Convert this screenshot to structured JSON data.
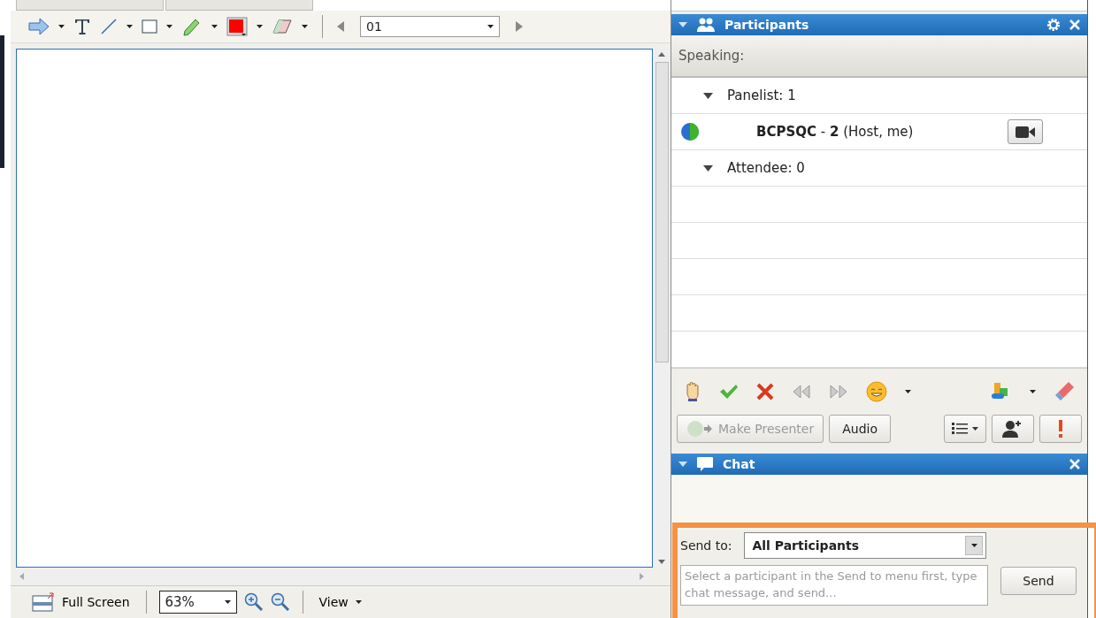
{
  "whiteboard": {
    "page": "01"
  },
  "bottom_bar": {
    "full_screen": "Full Screen",
    "zoom": "63%",
    "view": "View"
  },
  "participants": {
    "title": "Participants",
    "speaking": "Speaking:",
    "groups": [
      {
        "label": "Panelist: 1",
        "expanded": true,
        "children": [
          {
            "name": "**BCPSQC** - **2** (Host, me)"
          }
        ]
      },
      {
        "label": "Attendee: 0",
        "expanded": true
      }
    ],
    "buttons": [
      {
        "label": "Make Presenter",
        "disabled": true
      },
      {
        "label": "Audio",
        "disabled": false
      }
    ]
  },
  "chat": {
    "title": "Chat",
    "send_to_label": "Send to:",
    "send_to": "All Participants",
    "placeholder": "Select a participant in the Send to menu first, type chat message, and send...",
    "send": "Send"
  }
}
